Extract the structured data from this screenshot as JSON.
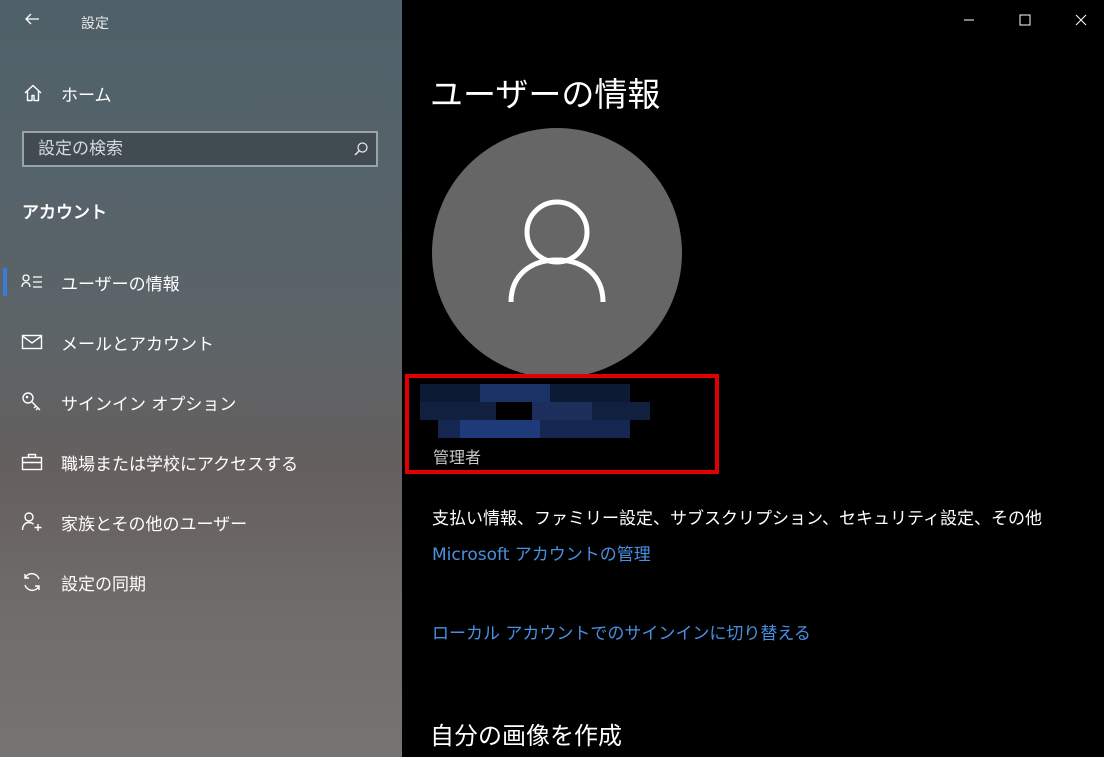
{
  "app": {
    "title": "設定"
  },
  "sidebar": {
    "home_label": "ホーム",
    "search_placeholder": "設定の検索",
    "section_title": "アカウント",
    "items": [
      {
        "label": "ユーザーの情報",
        "icon": "person-list-icon",
        "active": true
      },
      {
        "label": "メールとアカウント",
        "icon": "mail-icon",
        "active": false
      },
      {
        "label": "サインイン オプション",
        "icon": "key-icon",
        "active": false
      },
      {
        "label": "職場または学校にアクセスする",
        "icon": "briefcase-icon",
        "active": false
      },
      {
        "label": "家族とその他のユーザー",
        "icon": "person-add-icon",
        "active": false
      },
      {
        "label": "設定の同期",
        "icon": "sync-icon",
        "active": false
      }
    ]
  },
  "main": {
    "title": "ユーザーの情報",
    "account_role": "管理者",
    "info_text": "支払い情報、ファミリー設定、サブスクリプション、セキュリティ設定、その他",
    "manage_link": "Microsoft アカウントの管理",
    "switch_link": "ローカル アカウントでのサインインに切り替える",
    "create_picture_heading": "自分の画像を作成"
  },
  "colors": {
    "accent": "#3a7bd5",
    "link": "#4a90e2",
    "highlight_border": "#e00000",
    "avatar_bg": "#666666"
  }
}
